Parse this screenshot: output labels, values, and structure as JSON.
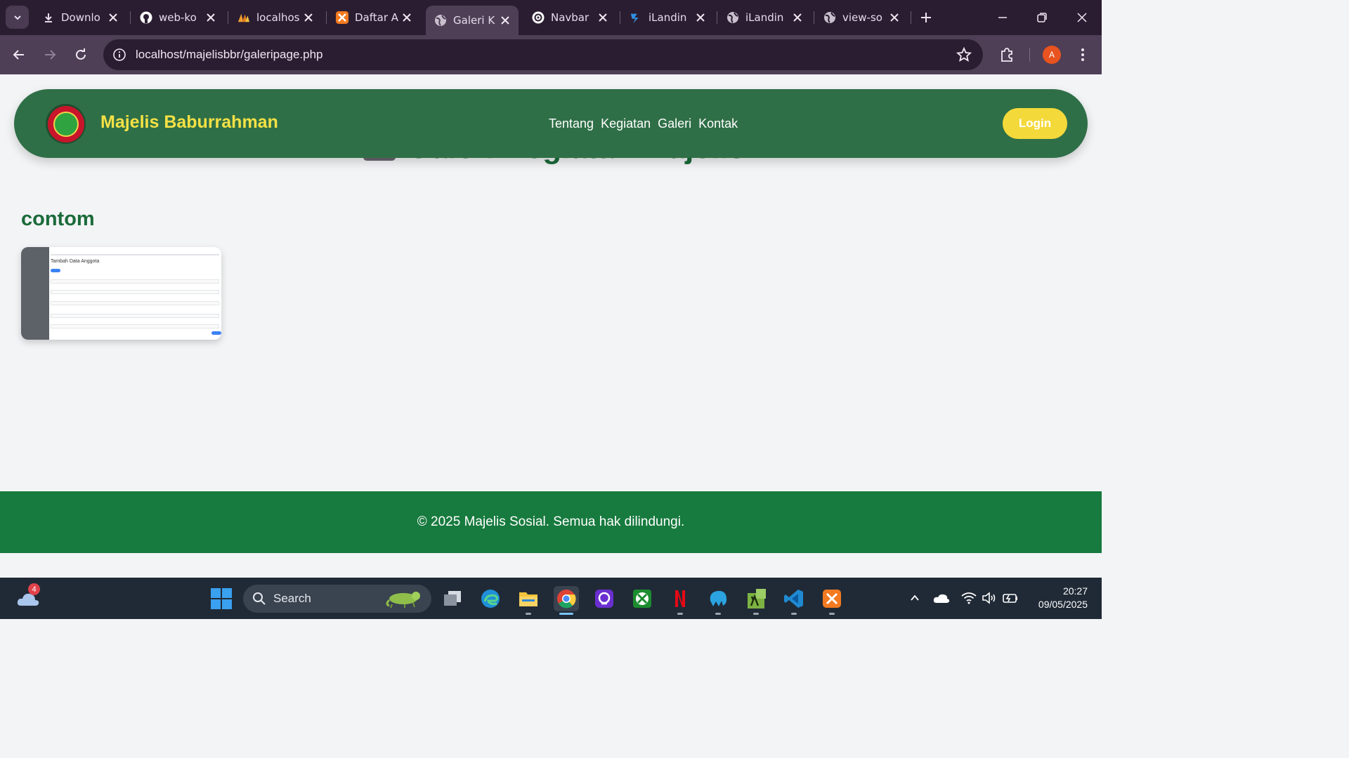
{
  "browser": {
    "tabs": [
      {
        "title": "Downlo",
        "icon": "download-icon"
      },
      {
        "title": "web-ko",
        "icon": "github-icon"
      },
      {
        "title": "localhos",
        "icon": "phpmyadmin-icon"
      },
      {
        "title": "Daftar A",
        "icon": "xampp-icon"
      },
      {
        "title": "Galeri K",
        "icon": "globe-icon",
        "active": true
      },
      {
        "title": "Navbar",
        "icon": "openai-icon"
      },
      {
        "title": "iLandin",
        "icon": "tailwind-icon"
      },
      {
        "title": "iLandin",
        "icon": "globe-icon"
      },
      {
        "title": "view-so",
        "icon": "globe-icon"
      }
    ],
    "url": "localhost/majelisbbr/galeripage.php",
    "profile_initial": "A",
    "accent": "#4e3f56"
  },
  "page": {
    "hidden_heading": "Galeri Kegiatan Majelis",
    "navbar": {
      "brand": "Majelis Baburrahman",
      "links": [
        "Tentang",
        "Kegiatan",
        "Galeri",
        "Kontak"
      ],
      "login": "Login",
      "color": "#2f6f47",
      "brand_color": "#f5e145"
    },
    "albums": [
      {
        "title": "contom",
        "thumbnail": {
          "heading": "Tambah Data Anggota"
        }
      }
    ],
    "footer": "© 2025 Majelis Sosial. Semua hak dilindungi."
  },
  "taskbar": {
    "weather_badge": "4",
    "search_label": "Search",
    "apps": [
      "task-view-icon",
      "edge-icon",
      "file-explorer-icon",
      "chrome-icon",
      "photo-app-icon",
      "xbox-icon",
      "netflix-icon",
      "mysql-workbench-icon",
      "calculator-lambda-icon",
      "vscode-icon",
      "xampp-icon"
    ],
    "time": "20:27",
    "date": "09/05/2025"
  }
}
